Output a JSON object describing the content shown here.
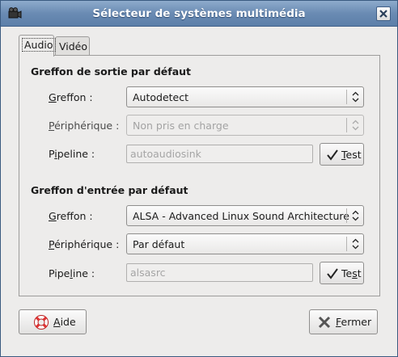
{
  "window": {
    "title": "Sélecteur de systèmes multimédia",
    "app_icon": "camera-icon",
    "close_icon": "close-icon"
  },
  "tabs": [
    {
      "label": "Audio",
      "selected": true
    },
    {
      "label": "Vidéo",
      "selected": false
    }
  ],
  "output": {
    "section_title": "Greffon de sortie par défaut",
    "plugin_label_u": "G",
    "plugin_label_rest": "reffon :",
    "plugin_value": "Autodetect",
    "device_label_u": "P",
    "device_label_rest": "ériphérique :",
    "device_value": "Non pris en charge",
    "pipeline_label_pre": "P",
    "pipeline_label_u": "i",
    "pipeline_label_rest": "peline :",
    "pipeline_value": "autoaudiosink",
    "test_pre": "",
    "test_u": "T",
    "test_rest": "est"
  },
  "input": {
    "section_title": "Greffon d'entrée par défaut",
    "plugin_label_u": "G",
    "plugin_label_rest": "reffon :",
    "plugin_value": "ALSA - Advanced Linux Sound Architecture",
    "device_label_u": "P",
    "device_label_rest": "ériphérique :",
    "device_value": "Par défaut",
    "pipeline_label_pre": "Pipe",
    "pipeline_label_u": "l",
    "pipeline_label_rest": "ine :",
    "pipeline_value": "alsasrc",
    "test_pre": "Te",
    "test_u": "s",
    "test_rest": "t"
  },
  "footer": {
    "help_u": "A",
    "help_rest": "ide",
    "help_icon": "lifebuoy-icon",
    "close_u": "F",
    "close_rest": "ermer",
    "close_icon": "close-x-icon"
  },
  "colors": {
    "titlebar": "#6a8bb3",
    "window_bg": "#edeceb"
  }
}
